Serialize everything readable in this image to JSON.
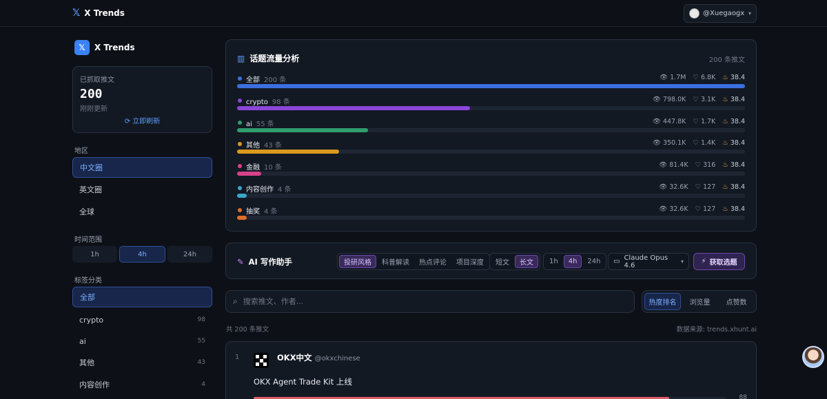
{
  "app": {
    "brand_icon": "x-logo-icon",
    "title": "X Trends"
  },
  "user": {
    "handle": "@Xuegaogx"
  },
  "sidebar": {
    "brand": "X Trends",
    "stats": {
      "label": "已抓取推文",
      "value": "200",
      "sub": "刚刚更新",
      "refresh_label": "立即刷新"
    },
    "region_title": "地区",
    "regions": [
      {
        "label": "中文圈",
        "active": true
      },
      {
        "label": "英文圈",
        "active": false
      },
      {
        "label": "全球",
        "active": false
      }
    ],
    "time_title": "时间范围",
    "times": [
      {
        "label": "1h",
        "active": false
      },
      {
        "label": "4h",
        "active": true
      },
      {
        "label": "24h",
        "active": false
      }
    ],
    "tag_title": "标签分类",
    "tags": [
      {
        "label": "全部",
        "count": "",
        "active": true
      },
      {
        "label": "crypto",
        "count": "98",
        "active": false
      },
      {
        "label": "ai",
        "count": "55",
        "active": false
      },
      {
        "label": "其他",
        "count": "43",
        "active": false
      },
      {
        "label": "内容创作",
        "count": "4",
        "active": false
      }
    ]
  },
  "analysis": {
    "title": "话题流量分析",
    "total": "200 条推文",
    "topics": [
      {
        "name": "全部",
        "count": "200 条",
        "views": "1.7M",
        "likes": "6.8K",
        "heat": "38.4",
        "share": 1.0,
        "color": "#3b6fe0"
      },
      {
        "name": "crypto",
        "count": "98 条",
        "views": "798.0K",
        "likes": "3.1K",
        "heat": "38.4",
        "share": 0.458,
        "color": "#8b46d8"
      },
      {
        "name": "ai",
        "count": "55 条",
        "views": "447.8K",
        "likes": "1.7K",
        "heat": "38.4",
        "share": 0.258,
        "color": "#2f9d6e"
      },
      {
        "name": "其他",
        "count": "43 条",
        "views": "350.1K",
        "likes": "1.4K",
        "heat": "38.4",
        "share": 0.201,
        "color": "#d99a1f"
      },
      {
        "name": "金融",
        "count": "10 条",
        "views": "81.4K",
        "likes": "316",
        "heat": "38.4",
        "share": 0.047,
        "color": "#d8428a"
      },
      {
        "name": "内容创作",
        "count": "4 条",
        "views": "32.6K",
        "likes": "127",
        "heat": "38.4",
        "share": 0.019,
        "color": "#3aa7c9"
      },
      {
        "name": "抽奖",
        "count": "4 条",
        "views": "32.6K",
        "likes": "127",
        "heat": "38.4",
        "share": 0.019,
        "color": "#e06d2a"
      }
    ]
  },
  "assistant": {
    "title": "AI 写作助手",
    "styles": [
      {
        "label": "投研风格",
        "active": true
      },
      {
        "label": "科普解读",
        "active": false
      },
      {
        "label": "热点评论",
        "active": false
      },
      {
        "label": "项目深度",
        "active": false
      }
    ],
    "lengths": [
      {
        "label": "短文",
        "active": false
      },
      {
        "label": "长文",
        "active": true
      }
    ],
    "windows": [
      {
        "label": "1h",
        "active": false
      },
      {
        "label": "4h",
        "active": true
      },
      {
        "label": "24h",
        "active": false
      }
    ],
    "model": "Claude Opus 4.6",
    "fetch_label": "获取选题"
  },
  "search": {
    "placeholder": "搜索推文、作者...",
    "sorts": [
      {
        "label": "热度排名",
        "active": true
      },
      {
        "label": "浏览量",
        "active": false
      },
      {
        "label": "点赞数",
        "active": false
      }
    ]
  },
  "list": {
    "count_text": "共 200 条推文",
    "source_text": "数据来源: trends.xhunt.ai",
    "tweets": [
      {
        "rank": "1",
        "author": "OKX中文",
        "handle": "@okxchinese",
        "text": "OKX Agent Trade Kit 上线",
        "score": "88",
        "score_fraction": 0.88
      }
    ]
  }
}
